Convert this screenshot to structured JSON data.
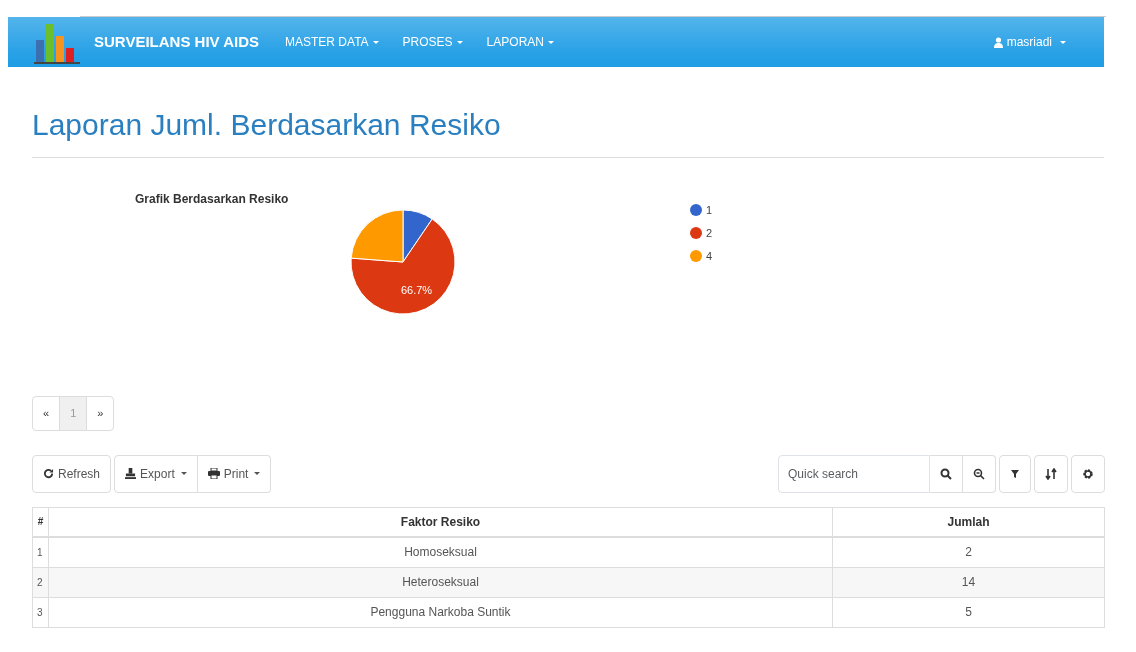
{
  "navbar": {
    "brand": "SURVEILANS HIV AIDS",
    "menus": [
      {
        "label": "MASTER DATA"
      },
      {
        "label": "PROSES"
      },
      {
        "label": "LAPORAN"
      }
    ],
    "user": "masriadi"
  },
  "page_title": "Laporan Juml. Berdasarkan Resiko",
  "chart": {
    "chart_data": {
      "type": "pie",
      "title": "Grafik Berdasarkan Resiko",
      "categories": [
        "1",
        "2",
        "4"
      ],
      "values": [
        9.5,
        66.7,
        23.8
      ],
      "colors": [
        "#3366cc",
        "#dc3912",
        "#ff9900"
      ],
      "legend": true,
      "annotations": [
        {
          "x": "2",
          "text": "66.7%"
        }
      ]
    }
  },
  "pagination": {
    "prev": "«",
    "pages": [
      {
        "label": "1",
        "selected": true
      }
    ],
    "next": "»"
  },
  "toolbar": {
    "buttons": [
      {
        "kind": "refresh",
        "label": "Refresh",
        "caret": false
      },
      {
        "kind": "export",
        "label": "Export",
        "caret": true
      },
      {
        "kind": "print",
        "label": "Print",
        "caret": true
      }
    ],
    "search_placeholder": "Quick search"
  },
  "table": {
    "columns": [
      "#",
      "Faktor Resiko",
      "Jumlah"
    ],
    "rows": [
      [
        "1",
        "Homoseksual",
        "2"
      ],
      [
        "2",
        "Heteroseksual",
        "14"
      ],
      [
        "3",
        "Pengguna Narkoba Suntik",
        "5"
      ]
    ]
  }
}
